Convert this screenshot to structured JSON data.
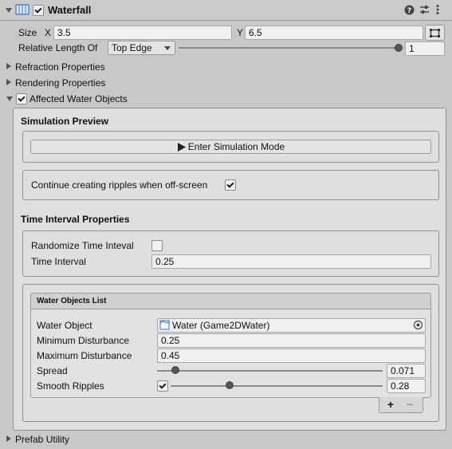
{
  "component": {
    "title": "Waterfall",
    "enabled": true,
    "icons": [
      "waterfall-component-icon",
      "help-icon",
      "preset-icon",
      "overflow-menu-icon"
    ]
  },
  "size": {
    "label": "Size",
    "x_label": "X",
    "x_value": "3.5",
    "y_label": "Y",
    "y_value": "6.5"
  },
  "relative_length": {
    "label": "Relative Length Of",
    "selected": "Top Edge",
    "value": "1",
    "slider_fraction": 1.0
  },
  "foldouts": {
    "refraction": "Refraction Properties",
    "rendering": "Rendering Properties",
    "affected": "Affected Water Objects",
    "prefab": "Prefab Utility"
  },
  "simulation": {
    "heading": "Simulation Preview",
    "button_label": "Enter Simulation Mode",
    "offscreen_label": "Continue creating ripples when off-screen",
    "offscreen_checked": true
  },
  "time_interval": {
    "heading": "Time Interval Properties",
    "randomize_label": "Randomize Time Inteval",
    "randomize_checked": false,
    "interval_label": "Time Interval",
    "interval_value": "0.25"
  },
  "water_list": {
    "title": "Water Objects List",
    "water_object_label": "Water Object",
    "water_object_value": "Water (Game2DWater)",
    "min_disturbance_label": "Minimum Disturbance",
    "min_disturbance_value": "0.25",
    "max_disturbance_label": "Maximum Disturbance",
    "max_disturbance_value": "0.45",
    "spread_label": "Spread",
    "spread_value": "0.071",
    "spread_fraction": 0.08,
    "smooth_label": "Smooth Ripples",
    "smooth_checked": true,
    "smooth_value": "0.28",
    "smooth_fraction": 0.28,
    "add_label": "+",
    "remove_label": "−"
  }
}
